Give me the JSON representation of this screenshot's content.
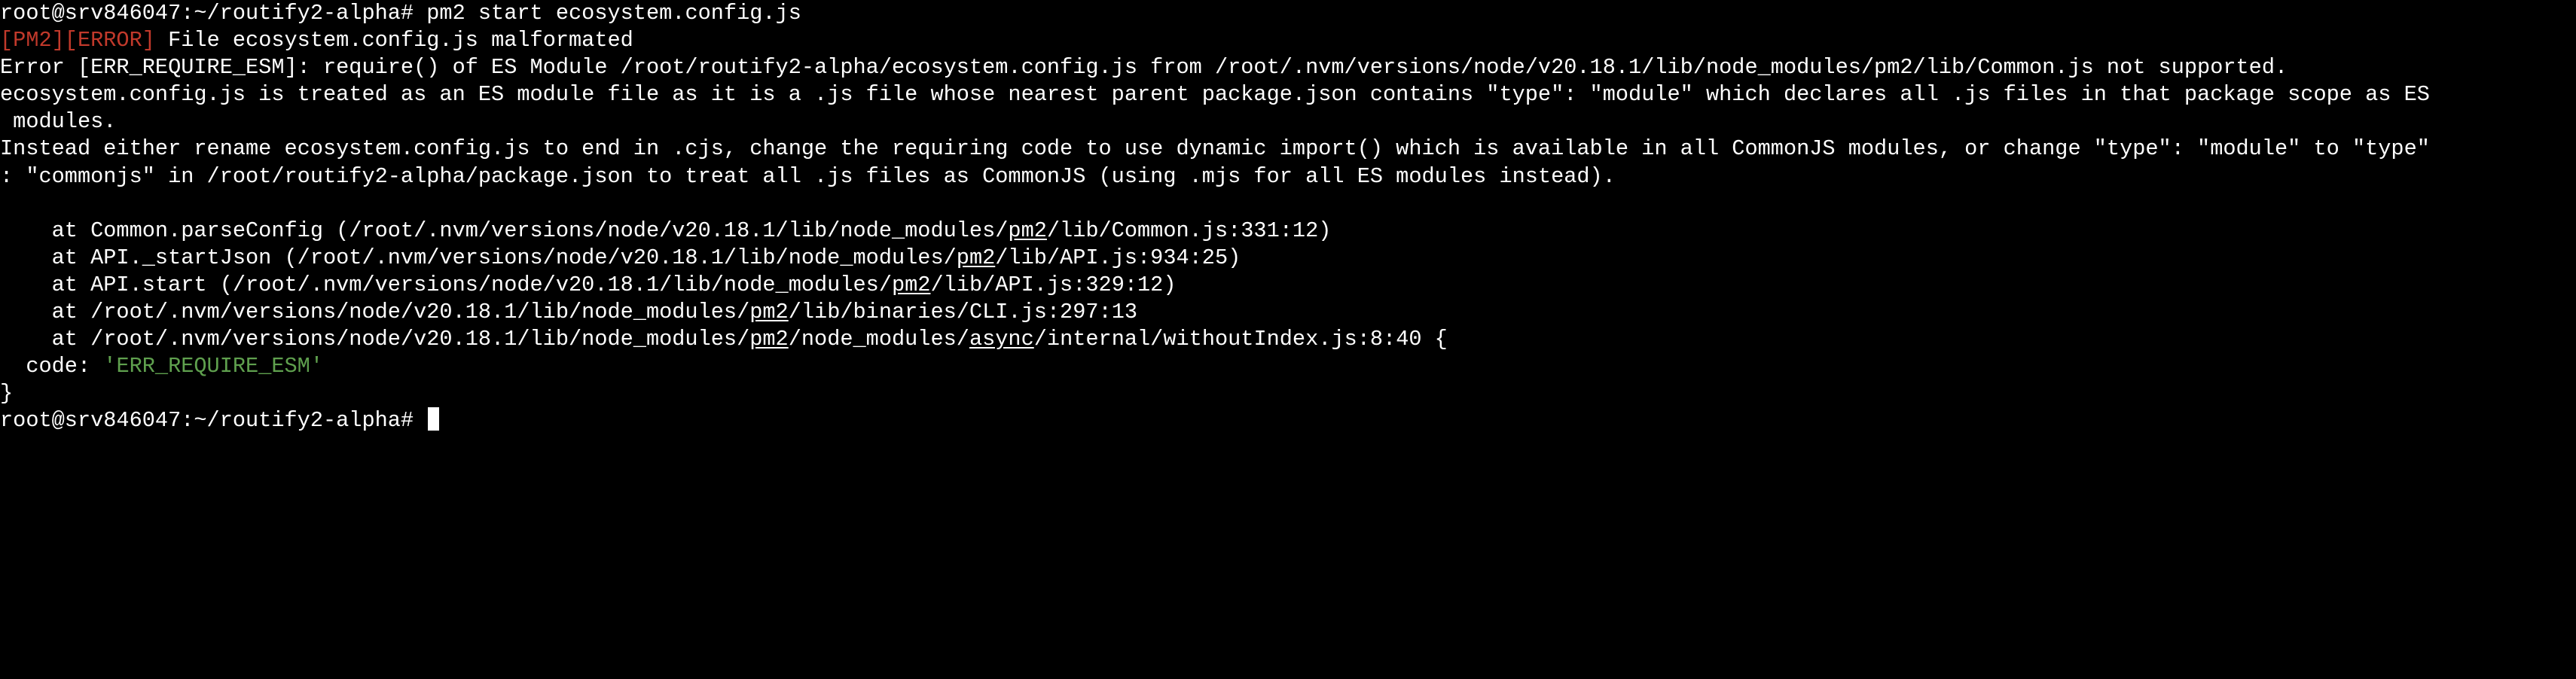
{
  "terminal": {
    "prompt": "root@srv846047:~/routify2-alpha#",
    "command": "pm2 start ecosystem.config.js",
    "tag": "[PM2][ERROR]",
    "tag_message": "File ecosystem.config.js malformated",
    "error_lines": [
      "Error [ERR_REQUIRE_ESM]: require() of ES Module /root/routify2-alpha/ecosystem.config.js from /root/.nvm/versions/node/v20.18.1/lib/node_modules/pm2/lib/Common.js not supported.",
      "ecosystem.config.js is treated as an ES module file as it is a .js file whose nearest parent package.json contains \"type\": \"module\" which declares all .js files in that package scope as ES",
      " modules.",
      "Instead either rename ecosystem.config.js to end in .cjs, change the requiring code to use dynamic import() which is available in all CommonJS modules, or change \"type\": \"module\" to \"type\"",
      ": \"commonjs\" in /root/routify2-alpha/package.json to treat all .js files as CommonJS (using .mjs for all ES modules instead)."
    ],
    "stack": [
      {
        "before": "    at Common.parseConfig (/root/.nvm/versions/node/v20.18.1/lib/node_modules/",
        "link": "pm2",
        "after": "/lib/Common.js:331:12)"
      },
      {
        "before": "    at API._startJson (/root/.nvm/versions/node/v20.18.1/lib/node_modules/",
        "link": "pm2",
        "after": "/lib/API.js:934:25)"
      },
      {
        "before": "    at API.start (/root/.nvm/versions/node/v20.18.1/lib/node_modules/",
        "link": "pm2",
        "after": "/lib/API.js:329:12)"
      },
      {
        "before": "    at /root/.nvm/versions/node/v20.18.1/lib/node_modules/",
        "link": "pm2",
        "after": "/lib/binaries/CLI.js:297:13"
      }
    ],
    "stack_last": {
      "part1": "    at /root/.nvm/versions/node/v20.18.1/lib/node_modules/",
      "link1": "pm2",
      "part2": "/node_modules/",
      "link2": "async",
      "part3": "/internal/withoutIndex.js:8:40 {"
    },
    "code_label": "  code: ",
    "code_value": "'ERR_REQUIRE_ESM'",
    "close_brace": "}",
    "colors": {
      "background": "#000000",
      "text": "#ffffff",
      "error_tag": "#c1392b",
      "string": "#5fa04e"
    }
  }
}
